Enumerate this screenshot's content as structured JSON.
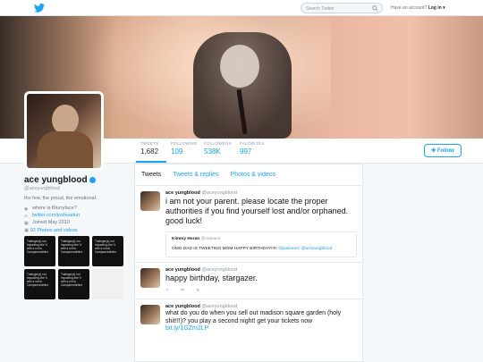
{
  "topbar": {
    "search_placeholder": "Search Twitter",
    "login_prompt": "Have an account?",
    "login_label": "Log in ▾"
  },
  "nav": {
    "stats": [
      {
        "label": "TWEETS",
        "value": "1,682"
      },
      {
        "label": "FOLLOWING",
        "value": "109"
      },
      {
        "label": "FOLLOWERS",
        "value": "538K"
      },
      {
        "label": "FAVORITES",
        "value": "997"
      }
    ],
    "follow_label": "Follow"
  },
  "profile": {
    "name": "ace yungblood",
    "handle": "@aceyungblood",
    "bio": "the few, the proud, the emotional.",
    "location": "where is Blurryface?",
    "website": "twitter.com/joshuadun",
    "joined": "Joined May 2010",
    "photos_label": "92 Photos and videos"
  },
  "thumbs": [
    "Traileger(a) not impacting dire’ it with a not to Campaneedeline",
    "Traileger(a) not impacting dire’ it with a not to Campaneedeline",
    "Traileger(a) not impacting dire’ it with a not to Campaneedeline",
    "Traileger(a) not impacting dire’ it with a not to Campaneedeline",
    "Traileger(a) not impacting dire’ it with a not to Campaneedeline",
    ""
  ],
  "timeline": {
    "tabs": [
      "Tweets",
      "Tweets & replies",
      "Photos & videos"
    ],
    "tweets": [
      {
        "name": "ace yungblood",
        "handle": "@aceyungblood",
        "text": "i am not your parent. please locate the proper authorities if you find yourself lost and/or orphaned. good luck!",
        "quote": {
          "name": "Kimmy Horan",
          "handle": "@voteace",
          "text": "OMG DAD IS TWEETING MOM HAPPY BIRTHDAY!!!!! ",
          "mentions": "@joalvarez @aceyungblood"
        }
      },
      {
        "name": "ace yungblood",
        "handle": "@aceyungblood",
        "text": "happy birthday, stargazer."
      },
      {
        "name": "ace yungblood",
        "handle": "@aceyungblood",
        "text": "what do you do when you sell out madison square garden (holy shit!!!)? you play a second night! get your tickets now",
        "link": "bit.ly/1GZm2LP"
      }
    ]
  }
}
